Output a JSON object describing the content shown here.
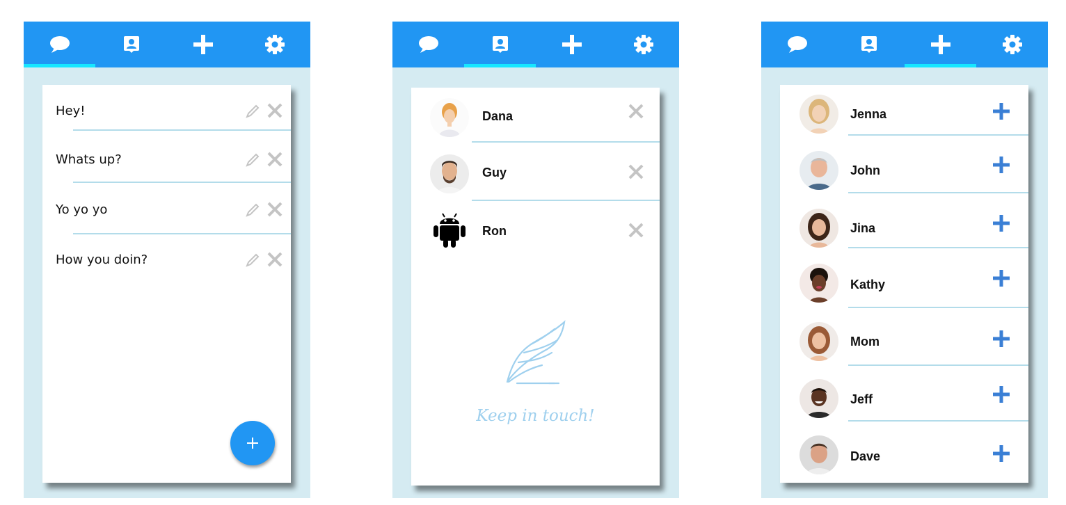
{
  "colors": {
    "primary": "#2196f3",
    "indicator": "#17e6ff",
    "background": "#d5ebf2",
    "divider": "#b3dcea",
    "add_icon": "#3a7fd5",
    "muted_icon": "#c4c4c4"
  },
  "tabs": [
    {
      "icon": "chat-bubble-icon"
    },
    {
      "icon": "contact-card-icon"
    },
    {
      "icon": "plus-icon"
    },
    {
      "icon": "gear-icon"
    }
  ],
  "screen_messages": {
    "active_tab": 0,
    "messages": [
      {
        "text": "Hey!"
      },
      {
        "text": "Whats up?"
      },
      {
        "text": "Yo yo yo"
      },
      {
        "text": "How you doin?"
      }
    ],
    "fab_icon": "plus-icon"
  },
  "screen_contacts": {
    "active_tab": 1,
    "contacts": [
      {
        "name": "Dana",
        "avatar": "person-photo"
      },
      {
        "name": "Guy",
        "avatar": "person-photo"
      },
      {
        "name": "Ron",
        "avatar": "android-robot-icon"
      }
    ],
    "empty_illustration": "feather-wing-icon",
    "tagline": "Keep in touch!"
  },
  "screen_suggestions": {
    "active_tab": 2,
    "people": [
      {
        "name": "Jenna"
      },
      {
        "name": "John"
      },
      {
        "name": "Jina"
      },
      {
        "name": "Kathy"
      },
      {
        "name": "Mom"
      },
      {
        "name": "Jeff"
      },
      {
        "name": "Dave"
      }
    ]
  }
}
